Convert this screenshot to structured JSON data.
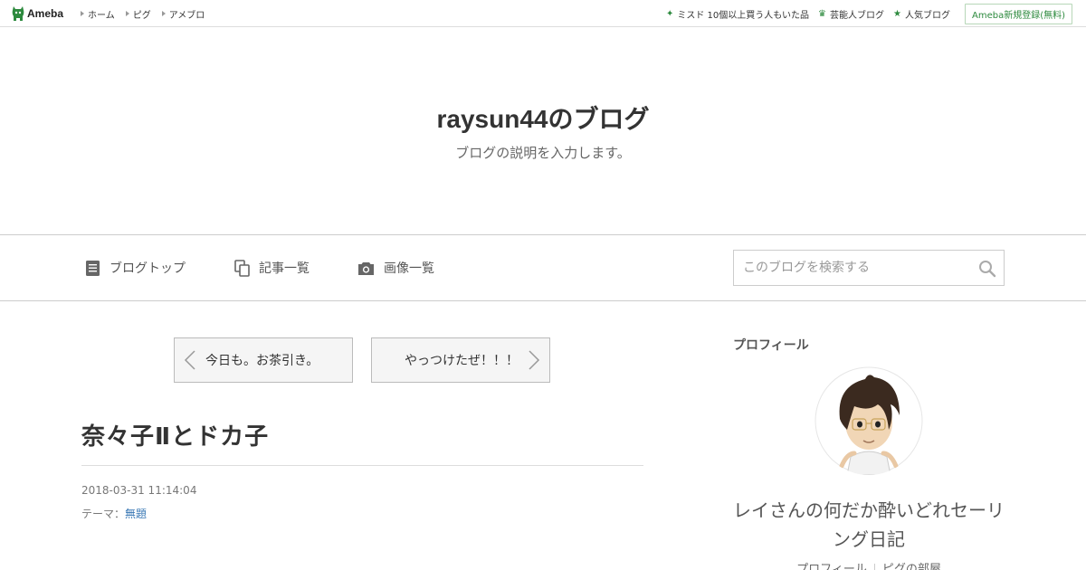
{
  "topbar": {
    "logo_text": "Ameba",
    "nav": [
      "ホーム",
      "ピグ",
      "アメブロ"
    ],
    "right": [
      {
        "icon": "sparkle-icon",
        "label": "ミスド 10個以上買う人もいた品"
      },
      {
        "icon": "crown-icon",
        "label": "芸能人ブログ"
      },
      {
        "icon": "star-icon",
        "label": "人気ブログ"
      }
    ],
    "signup_label": "Ameba新規登録(無料)",
    "accent": "#2d8a3e"
  },
  "header": {
    "title": "raysun44のブログ",
    "description": "ブログの説明を入力します。"
  },
  "menu": {
    "items": [
      "ブログトップ",
      "記事一覧",
      "画像一覧"
    ],
    "search_placeholder": "このブログを検索する"
  },
  "pager": {
    "prev_label": "今日も。お茶引き。",
    "next_label": "やっつけたぜ！！！"
  },
  "article": {
    "title": "奈々子Ⅱとドカ子",
    "date": "2018-03-31 11:14:04",
    "theme_label": "テーマ：",
    "theme_value": "無題"
  },
  "sidebar": {
    "heading": "プロフィール",
    "name": "レイさんの何だか酔いどれセーリング日記",
    "links": [
      "プロフィール",
      "ピグの部屋"
    ]
  }
}
